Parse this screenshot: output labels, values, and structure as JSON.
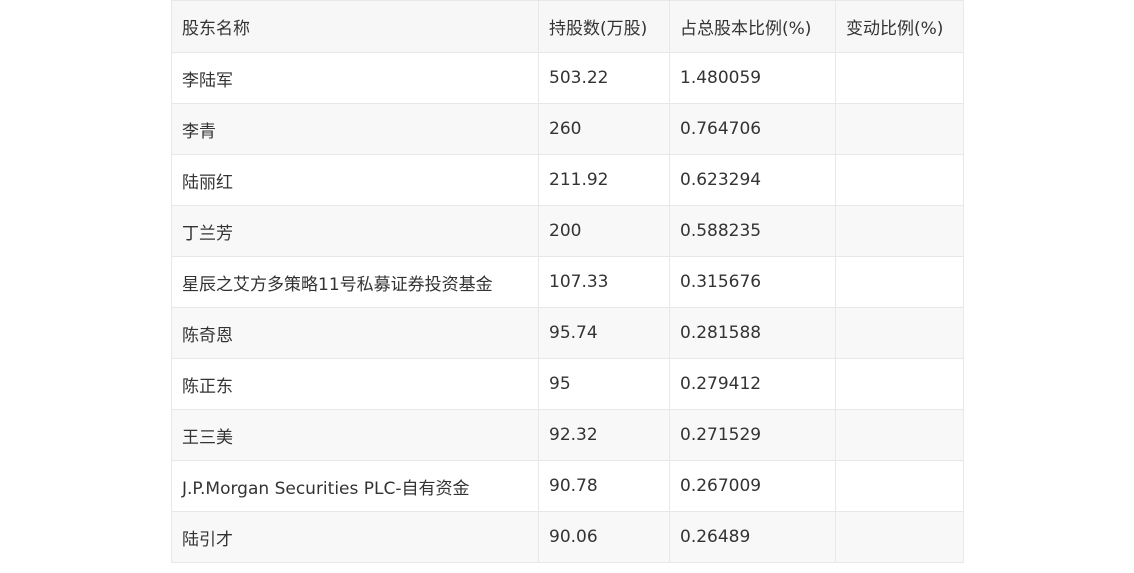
{
  "table": {
    "headers": [
      "股东名称",
      "持股数(万股)",
      "占总股本比例(%)",
      "变动比例(%)"
    ],
    "rows": [
      {
        "name": "李陆军",
        "shares": "503.22",
        "ratio": "1.480059",
        "change": ""
      },
      {
        "name": "李青",
        "shares": "260",
        "ratio": "0.764706",
        "change": ""
      },
      {
        "name": "陆丽红",
        "shares": "211.92",
        "ratio": "0.623294",
        "change": ""
      },
      {
        "name": "丁兰芳",
        "shares": "200",
        "ratio": "0.588235",
        "change": ""
      },
      {
        "name": "星辰之艾方多策略11号私募证券投资基金",
        "shares": "107.33",
        "ratio": "0.315676",
        "change": ""
      },
      {
        "name": "陈奇恩",
        "shares": "95.74",
        "ratio": "0.281588",
        "change": ""
      },
      {
        "name": "陈正东",
        "shares": "95",
        "ratio": "0.279412",
        "change": ""
      },
      {
        "name": "王三美",
        "shares": "92.32",
        "ratio": "0.271529",
        "change": ""
      },
      {
        "name": "J.P.Morgan Securities PLC-自有资金",
        "shares": "90.78",
        "ratio": "0.267009",
        "change": ""
      },
      {
        "name": "陆引才",
        "shares": "90.06",
        "ratio": "0.26489",
        "change": ""
      }
    ]
  }
}
